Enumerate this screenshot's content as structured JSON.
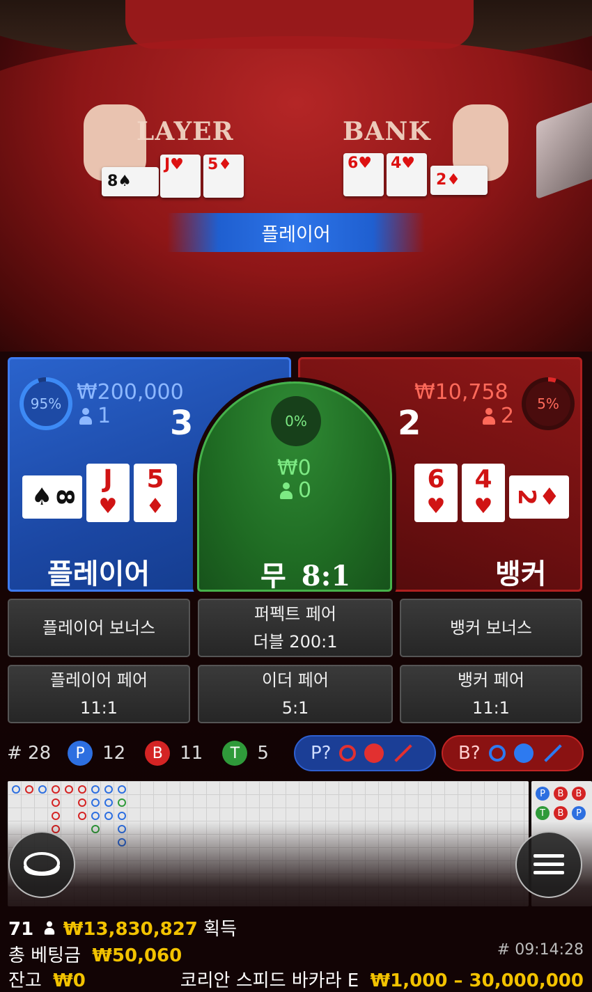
{
  "video": {
    "table_player_label": "LAYER",
    "table_banker_label": "BANK",
    "result_banner": "플레이어"
  },
  "player": {
    "percent": "95%",
    "percent_value": 95,
    "amount": "₩200,000",
    "bettors": "1",
    "score": "3",
    "title": "플레이어",
    "cards": [
      {
        "rank": "8",
        "suit": "♠",
        "color": "#111111",
        "sideways": true
      },
      {
        "rank": "J",
        "suit": "♥",
        "color": "#d01414",
        "sideways": false
      },
      {
        "rank": "5",
        "suit": "♦",
        "color": "#d01414",
        "sideways": false
      }
    ]
  },
  "tie": {
    "percent": "0%",
    "amount": "₩0",
    "bettors": "0",
    "title": "무",
    "payout": "8:1"
  },
  "banker": {
    "percent": "5%",
    "percent_value": 5,
    "amount": "₩10,758",
    "bettors": "2",
    "score": "2",
    "title": "뱅커",
    "cards": [
      {
        "rank": "6",
        "suit": "♥",
        "color": "#d01414",
        "sideways": false
      },
      {
        "rank": "4",
        "suit": "♥",
        "color": "#d01414",
        "sideways": false
      },
      {
        "rank": "2",
        "suit": "♦",
        "color": "#d01414",
        "sideways": true
      }
    ]
  },
  "side_bets": {
    "player_bonus": "플레이어 보너스",
    "perfect_pair_line1": "퍼펙트 페어",
    "perfect_pair_line2": "더블 200:1",
    "banker_bonus": "뱅커 보너스",
    "player_pair_line1": "플레이어 페어",
    "player_pair_line2": "11:1",
    "either_pair_line1": "이더 페어",
    "either_pair_line2": "5:1",
    "banker_pair_line1": "뱅커 페어",
    "banker_pair_line2": "11:1"
  },
  "stats": {
    "round_label": "# 28",
    "p_badge": "P",
    "p_count": "12",
    "b_badge": "B",
    "b_count": "11",
    "t_badge": "T",
    "t_count": "5"
  },
  "predict": {
    "player_label": "P?",
    "banker_label": "B?"
  },
  "colors": {
    "player_blue": "#2d6fe0",
    "banker_red": "#d42424",
    "tie_green": "#2f9a3a",
    "gold": "#f2c200"
  },
  "bottom": {
    "players_online": "71",
    "winnings": "₩13,830,827",
    "winnings_label": "획득",
    "total_bet_label": "총 베팅금",
    "total_bet": "₩50,060",
    "balance_label": "잔고",
    "balance": "₩0",
    "time": "# 09:14:28",
    "table_name": "코리안 스피드 바카라 E",
    "limits": "₩1,000 – 30,000,000"
  },
  "icons": {
    "chip_button": "chip-icon",
    "menu_button": "hamburger-menu-icon"
  }
}
